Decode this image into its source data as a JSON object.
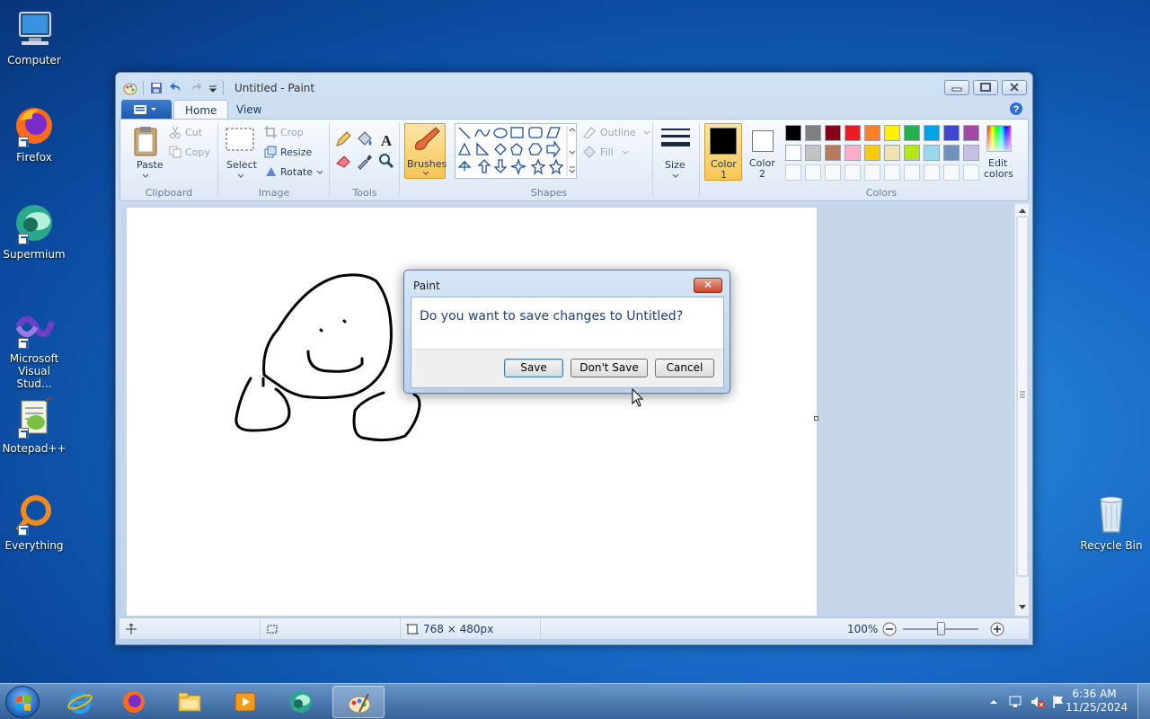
{
  "desktop": {
    "icons": [
      {
        "label": "Computer",
        "icon": "computer-icon"
      },
      {
        "label": "Firefox",
        "icon": "firefox-icon"
      },
      {
        "label": "Supermium",
        "icon": "supermium-icon"
      },
      {
        "label": "Microsoft Visual Stud...",
        "icon": "visual-studio-icon"
      },
      {
        "label": "Notepad++",
        "icon": "notepadpp-icon"
      },
      {
        "label": "Everything",
        "icon": "everything-icon"
      },
      {
        "label": "Recycle Bin",
        "icon": "recycle-bin-icon"
      }
    ]
  },
  "paint": {
    "title": "Untitled - Paint",
    "tabs": {
      "home": "Home",
      "view": "View"
    },
    "clipboard": {
      "paste": "Paste",
      "cut": "Cut",
      "copy": "Copy",
      "group": "Clipboard"
    },
    "image": {
      "select": "Select",
      "crop": "Crop",
      "resize": "Resize",
      "rotate": "Rotate",
      "group": "Image"
    },
    "tools": {
      "group": "Tools"
    },
    "brushes": {
      "label": "Brushes"
    },
    "shapes": {
      "outline": "Outline",
      "fill": "Fill",
      "group": "Shapes"
    },
    "size": {
      "label": "Size"
    },
    "color1": {
      "label": "Color",
      "num": "1",
      "value": "#000000"
    },
    "color2": {
      "label": "Color",
      "num": "2",
      "value": "#ffffff"
    },
    "colors": {
      "group": "Colors",
      "edit_line1": "Edit",
      "edit_line2": "colors",
      "row1": [
        "#000000",
        "#7f7f7f",
        "#880015",
        "#ed1c24",
        "#ff7f27",
        "#fff200",
        "#22b14c",
        "#00a2e8",
        "#3f48cc",
        "#a349a4"
      ],
      "row2": [
        "#ffffff",
        "#c3c3c3",
        "#b97a57",
        "#ffaec9",
        "#ffc90e",
        "#efe4b0",
        "#b5e61d",
        "#99d9ea",
        "#7092be",
        "#c8bfe7"
      ]
    },
    "status": {
      "dimensions": "768 × 480px",
      "zoom": "100%",
      "zoom_level": 1.0
    }
  },
  "dialog": {
    "title": "Paint",
    "close": "✕",
    "message": "Do you want to save changes to Untitled?",
    "buttons": {
      "save": "Save",
      "dont_save": "Don't Save",
      "cancel": "Cancel"
    }
  },
  "taskbar": {
    "items": [
      "internet-explorer-icon",
      "firefox-icon",
      "file-explorer-icon",
      "media-player-icon",
      "supermium-icon",
      "paint-icon"
    ],
    "time": "6:36 AM",
    "date": "11/25/2024"
  }
}
